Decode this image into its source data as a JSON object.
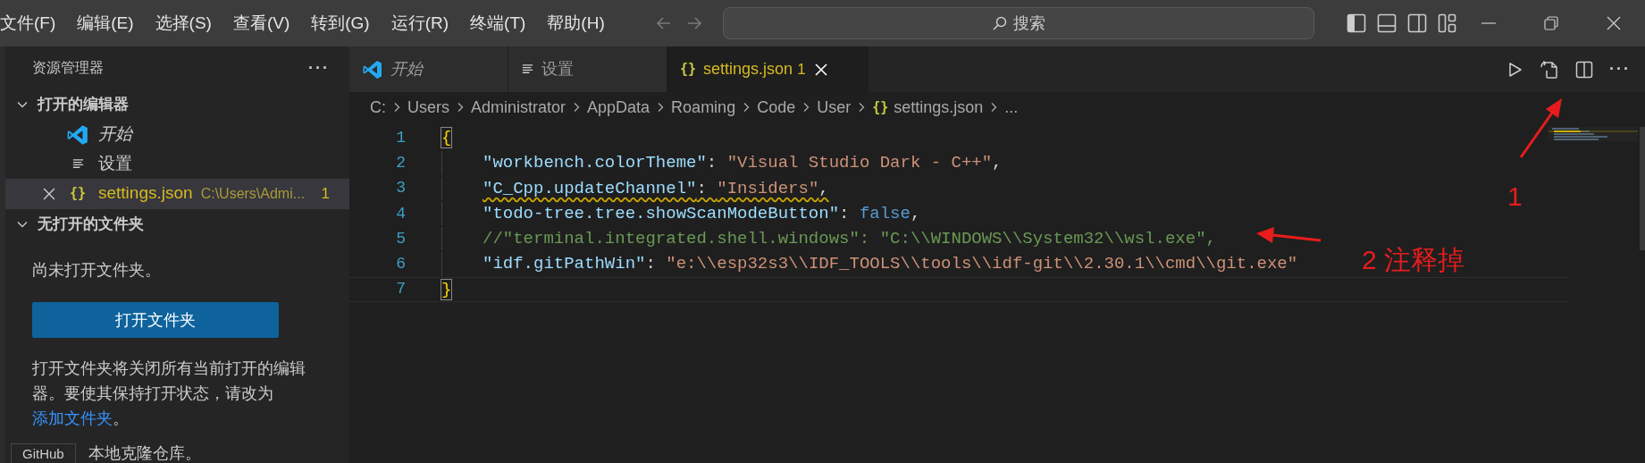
{
  "menu": [
    "文件(F)",
    "编辑(E)",
    "选择(S)",
    "查看(V)",
    "转到(G)",
    "运行(R)",
    "终端(T)",
    "帮助(H)"
  ],
  "search": {
    "placeholder": "搜索"
  },
  "tabs": [
    {
      "kind": "welcome",
      "label": "开始",
      "italic": true,
      "selected": false
    },
    {
      "kind": "settings",
      "label": "设置",
      "italic": false,
      "selected": false
    },
    {
      "kind": "json",
      "glyph": "{}",
      "label": "settings.json",
      "badge": "1",
      "italic": false,
      "selected": true
    }
  ],
  "editor_actions": {
    "more": "···"
  },
  "breadcrumb": [
    {
      "label": "C:"
    },
    {
      "label": "Users"
    },
    {
      "label": "Administrator"
    },
    {
      "label": "AppData"
    },
    {
      "label": "Roaming"
    },
    {
      "label": "Code"
    },
    {
      "label": "User"
    },
    {
      "kind": "json",
      "glyph": "{}",
      "label": "settings.json"
    },
    {
      "label": "..."
    }
  ],
  "sidebar": {
    "title": "资源管理器",
    "more": "···",
    "sections": [
      {
        "title": "打开的编辑器",
        "expanded": true,
        "kind": "editors",
        "items": [
          {
            "kind": "welcome",
            "label": "开始",
            "italic": true,
            "selected": false
          },
          {
            "kind": "settings",
            "label": "设置",
            "italic": false,
            "selected": false
          },
          {
            "kind": "json",
            "glyph": "{}",
            "label": "settings.json",
            "path": "C:\\Users\\Admi...",
            "badge": "1",
            "italic": false,
            "selected": true
          }
        ]
      },
      {
        "title": "无打开的文件夹",
        "expanded": true,
        "kind": "empty",
        "message": "尚未打开文件夹。",
        "button": "打开文件夹",
        "paragraph": {
          "before": "打开文件夹将关闭所有当前打开的编辑器。要使其保持打开状态，请改为",
          "link": "添加文件夹",
          "after": "。"
        },
        "clone_text": "本地克隆仓库。",
        "tooltip": "GitHub"
      }
    ]
  },
  "editor": {
    "lines": [
      {
        "number": "1",
        "indented": false,
        "squiggle": false,
        "current": false,
        "tokens": [
          {
            "kind": "brace",
            "text": "{",
            "matched": true
          }
        ]
      },
      {
        "number": "2",
        "indented": true,
        "squiggle": false,
        "current": false,
        "tokens": [
          {
            "kind": "key",
            "text": "\"workbench.colorTheme\""
          },
          {
            "kind": "punct",
            "text": ": "
          },
          {
            "kind": "string",
            "text": "\"Visual Studio Dark - C++\""
          },
          {
            "kind": "punct",
            "text": ","
          }
        ]
      },
      {
        "number": "3",
        "indented": true,
        "squiggle": true,
        "current": false,
        "tokens": [
          {
            "kind": "key",
            "text": "\"C_Cpp.updateChannel\""
          },
          {
            "kind": "punct",
            "text": ": "
          },
          {
            "kind": "string",
            "text": "\"Insiders\""
          },
          {
            "kind": "punct",
            "text": ","
          }
        ]
      },
      {
        "number": "4",
        "indented": true,
        "squiggle": false,
        "current": false,
        "tokens": [
          {
            "kind": "key",
            "text": "\"todo-tree.tree.showScanModeButton\""
          },
          {
            "kind": "punct",
            "text": ": "
          },
          {
            "kind": "bool",
            "text": "false"
          },
          {
            "kind": "punct",
            "text": ","
          }
        ]
      },
      {
        "number": "5",
        "indented": true,
        "squiggle": false,
        "current": false,
        "tokens": [
          {
            "kind": "comment",
            "text": "//\"terminal.integrated.shell.windows\": \"C:\\\\WINDOWS\\\\System32\\\\wsl.exe\","
          }
        ]
      },
      {
        "number": "6",
        "indented": true,
        "squiggle": false,
        "current": false,
        "tokens": [
          {
            "kind": "key",
            "text": "\"idf.gitPathWin\""
          },
          {
            "kind": "punct",
            "text": ": "
          },
          {
            "kind": "string",
            "text": "\"e:\\\\esp32s3\\\\IDF_TOOLS\\\\tools\\\\idf-git\\\\2.30.1\\\\cmd\\\\git.exe\""
          }
        ]
      },
      {
        "number": "7",
        "indented": false,
        "squiggle": false,
        "current": true,
        "tokens": [
          {
            "kind": "brace",
            "text": "}",
            "matched": true
          }
        ]
      }
    ]
  },
  "annotations": [
    {
      "text": "1"
    },
    {
      "text": "2 注释掉"
    }
  ]
}
